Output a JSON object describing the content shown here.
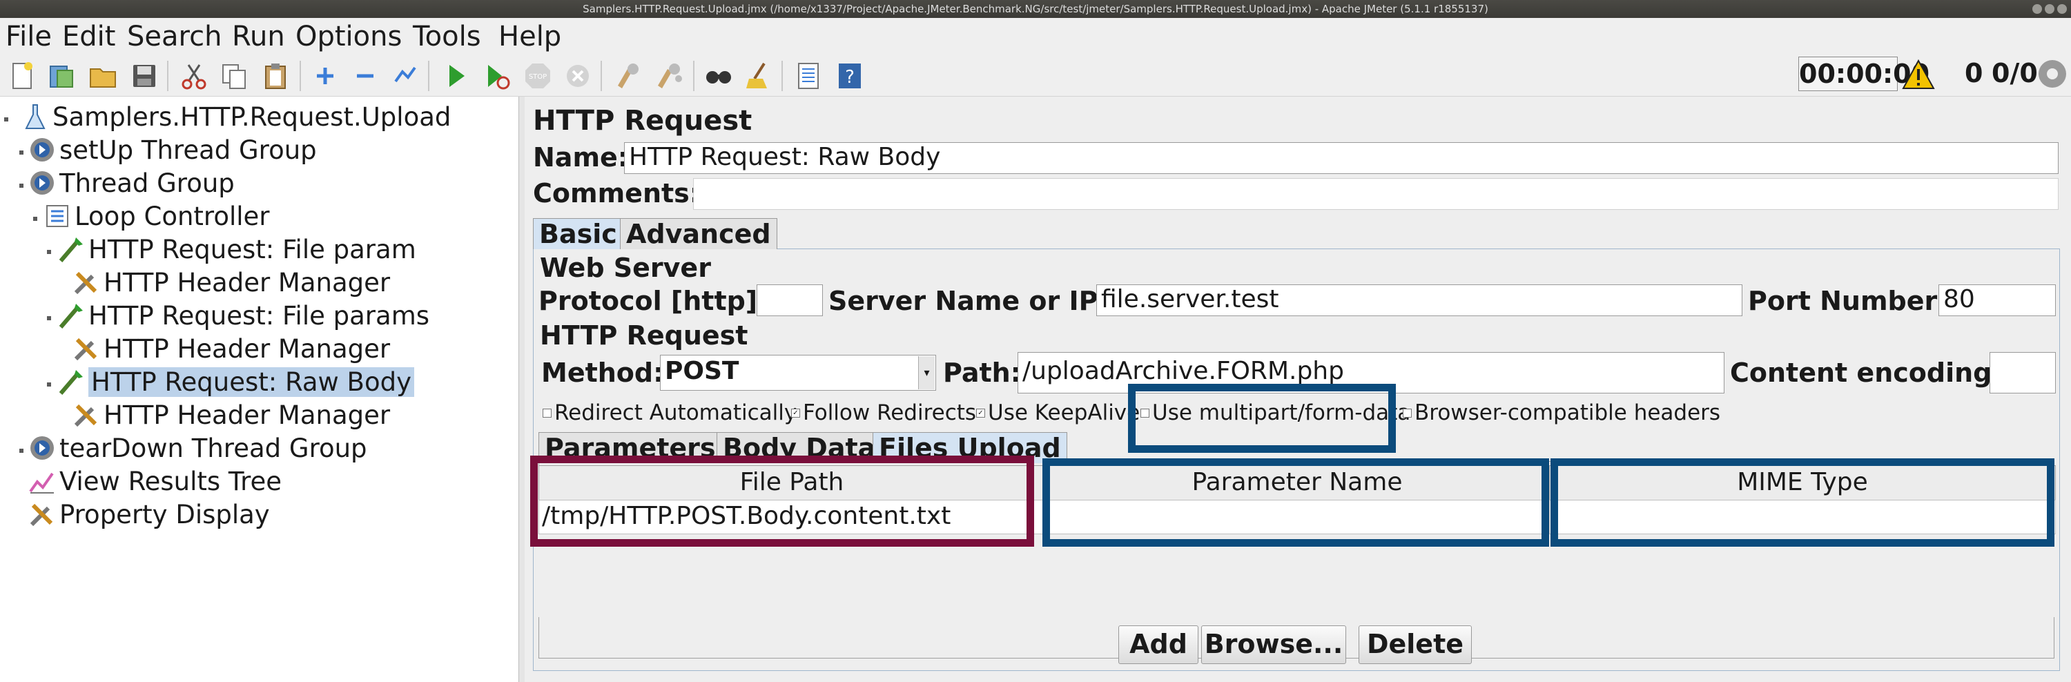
{
  "window": {
    "title": "Samplers.HTTP.Request.Upload.jmx (/home/x1337/Project/Apache.JMeter.Benchmark.NG/src/test/jmeter/Samplers.HTTP.Request.Upload.jmx) - Apache JMeter (5.1.1 r1855137)"
  },
  "menu": {
    "file": "File",
    "edit": "Edit",
    "search": "Search",
    "run": "Run",
    "options": "Options",
    "tools": "Tools",
    "help": "Help"
  },
  "toolbar": {
    "icons": [
      "new-icon",
      "templates-icon",
      "open-icon",
      "save-icon",
      "cut-icon",
      "copy-icon",
      "paste-icon",
      "expand-icon",
      "collapse-icon",
      "toggle-icon",
      "start-icon",
      "start-no-pauses-icon",
      "stop-icon",
      "shutdown-icon",
      "clear-icon",
      "clear-all-icon",
      "search-icon",
      "reset-search-icon",
      "function-helper-icon",
      "help-icon"
    ],
    "timer": "00:00:00",
    "error_count": "0",
    "thread_count": "0/0"
  },
  "tree": {
    "nodes": [
      {
        "label": "Samplers.HTTP.Request.Upload",
        "icon": "test-plan-icon"
      },
      {
        "label": "setUp Thread Group",
        "icon": "thread-group-icon"
      },
      {
        "label": "Thread Group",
        "icon": "thread-group-icon"
      },
      {
        "label": "Loop Controller",
        "icon": "controller-icon"
      },
      {
        "label": "HTTP Request: File param",
        "icon": "sampler-icon"
      },
      {
        "label": "HTTP Header Manager",
        "icon": "config-icon"
      },
      {
        "label": "HTTP Request: File params",
        "icon": "sampler-icon"
      },
      {
        "label": "HTTP Header Manager",
        "icon": "config-icon"
      },
      {
        "label": "HTTP Request: Raw Body",
        "icon": "sampler-icon",
        "selected": true
      },
      {
        "label": "HTTP Header Manager",
        "icon": "config-icon"
      },
      {
        "label": "tearDown Thread Group",
        "icon": "thread-group-icon"
      },
      {
        "label": "View Results Tree",
        "icon": "listener-icon"
      },
      {
        "label": "Property Display",
        "icon": "config-icon"
      }
    ]
  },
  "panel": {
    "title": "HTTP Request",
    "name_label": "Name:",
    "name_value": "HTTP Request: Raw Body",
    "comments_label": "Comments:",
    "comments_value": "",
    "tabs": {
      "basic": "Basic",
      "advanced": "Advanced"
    },
    "web_server": {
      "section": "Web Server",
      "protocol_label": "Protocol [http]:",
      "protocol_value": "",
      "server_label": "Server Name or IP:",
      "server_value": "file.server.test",
      "port_label": "Port Number:",
      "port_value": "80"
    },
    "http_request": {
      "section": "HTTP Request",
      "method_label": "Method:",
      "method_value": "POST",
      "path_label": "Path:",
      "path_value": "/uploadArchive.FORM.php",
      "encoding_label": "Content encoding:",
      "encoding_value": ""
    },
    "checkboxes": {
      "redirect_auto": {
        "label": "Redirect Automatically",
        "checked": false
      },
      "follow_redirects": {
        "label": "Follow Redirects",
        "checked": true
      },
      "keepalive": {
        "label": "Use KeepAlive",
        "checked": true
      },
      "multipart": {
        "label": "Use multipart/form-data",
        "checked": false
      },
      "browser_headers": {
        "label": "Browser-compatible headers",
        "checked": false
      }
    },
    "subtabs": {
      "parameters": "Parameters",
      "body_data": "Body Data",
      "files_upload": "Files Upload"
    },
    "files_table": {
      "columns": [
        "File Path",
        "Parameter Name",
        "MIME Type"
      ],
      "rows": [
        [
          "/tmp/HTTP.POST.Body.content.txt",
          "",
          ""
        ]
      ]
    },
    "buttons": {
      "add": "Add",
      "browse": "Browse...",
      "delete": "Delete"
    }
  },
  "colors": {
    "highlight_red": "#7a0f3b",
    "highlight_blue": "#0b4b7c",
    "selection": "#bcd2ea",
    "tab_active": "#d4e3f3"
  }
}
